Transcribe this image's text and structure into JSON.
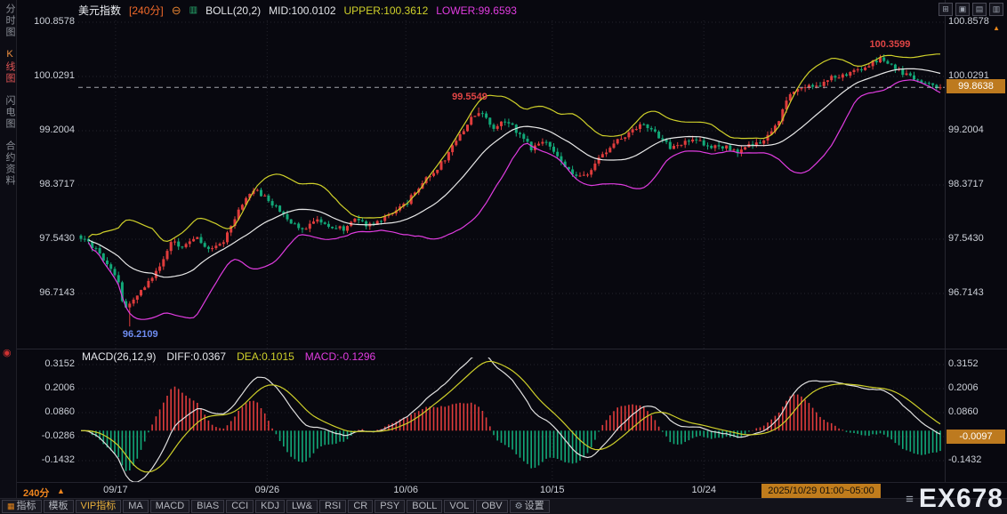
{
  "header": {
    "symbol": "美元指数",
    "period_tag": "[240分]",
    "boll_label": "BOLL(20,2)",
    "mid": "MID:100.0102",
    "upper": "UPPER:100.3612",
    "lower": "LOWER:99.6593"
  },
  "sidebar": {
    "tabs": [
      {
        "label": "分时图",
        "active": false
      },
      {
        "label": "K线图",
        "active": true
      },
      {
        "label": "闪电图",
        "active": false
      },
      {
        "label": "合约资料",
        "active": false
      }
    ]
  },
  "axis": {
    "price_labels": [
      "100.8578",
      "100.0291",
      "99.2004",
      "98.3717",
      "97.5430",
      "96.7143"
    ],
    "price_values": [
      100.8578,
      100.0291,
      99.2004,
      98.3717,
      97.543,
      96.7143
    ],
    "current_price": "99.8638",
    "macd_labels": [
      "0.3152",
      "0.2006",
      "0.0860",
      "-0.0286",
      "-0.1432"
    ],
    "macd_values": [
      0.3152,
      0.2006,
      0.086,
      -0.0286,
      -0.1432
    ],
    "macd_current": "-0.0097"
  },
  "annotations": {
    "low": "96.2109",
    "mid_peak": "99.5549",
    "high": "100.3599"
  },
  "macd_header": {
    "title": "MACD(26,12,9)",
    "diff": "DIFF:0.0367",
    "dea": "DEA:0.1015",
    "macd": "MACD:-0.1296"
  },
  "xaxis": {
    "period": "240分",
    "dates": [
      "09/17",
      "09/26",
      "10/06",
      "10/15",
      "10/24"
    ],
    "date_fracs": [
      0.043,
      0.218,
      0.378,
      0.547,
      0.722
    ],
    "current_range": "2025/10/29 01:00~05:00"
  },
  "toolbar": {
    "items": [
      "指标",
      "模板",
      "VIP指标",
      "MA",
      "MACD",
      "BIAS",
      "CCI",
      "KDJ",
      "LW&",
      "RSI",
      "CR",
      "PSY",
      "BOLL",
      "VOL",
      "OBV",
      "设置"
    ],
    "keys": [
      "indicators",
      "templates",
      "vip-indicators",
      "ma",
      "macd",
      "bias",
      "cci",
      "kdj",
      "lwr",
      "rsi",
      "cr",
      "psy",
      "boll",
      "vol",
      "obv",
      "settings"
    ],
    "vip_label": "VIP指标"
  },
  "watermark": {
    "text": "EX678"
  },
  "icons": {
    "zoom_out": "⊖",
    "boll_chart": "▥",
    "layout_grid": [
      "⊞",
      "▣",
      "▤",
      "▥"
    ],
    "gear": "⚙",
    "up_triangle": "▲",
    "red_dot": "◉",
    "menu": "≡",
    "indicator_grid": "▦"
  },
  "colors": {
    "up": "#e03c3c",
    "down": "#12a878",
    "boll_upper": "#cfd02a",
    "boll_mid": "#e8e8e8",
    "boll_lower": "#e03ce0",
    "diff_line": "#e0e0e0",
    "dea_line": "#cfd02a",
    "accent_orange": "#f0861e",
    "badge_bg": "#bd7a1f",
    "annotation_red": "#e04545",
    "annotation_blue": "#6e8cf0"
  },
  "chart_data": {
    "type": "candlestick",
    "title": "美元指数 240分 K线 + BOLL(20,2) + MACD(26,12,9)",
    "x_dates": [
      "09/17",
      "09/26",
      "10/06",
      "10/15",
      "10/24",
      "2025/10/29"
    ],
    "ylim": [
      95.9,
      100.95
    ],
    "price_gridlines": [
      100.8578,
      100.0291,
      99.2004,
      98.3717,
      97.543,
      96.7143
    ],
    "macd_gridlines": [
      0.3152,
      0.2006,
      0.086,
      -0.0286,
      -0.1432
    ],
    "key_points": {
      "low": 96.2109,
      "interim_high": 99.5549,
      "high": 100.3599,
      "last": 99.8638
    },
    "indicators": {
      "boll": {
        "period": 20,
        "mult": 2,
        "mid": 100.0102,
        "upper": 100.3612,
        "lower": 99.6593
      },
      "macd": {
        "fast": 12,
        "slow": 26,
        "signal": 9,
        "diff": 0.0367,
        "dea": 0.1015,
        "hist": -0.1296,
        "hist_at_axis": -0.0097
      }
    },
    "price_path": [
      [
        0,
        97.58
      ],
      [
        0.02,
        97.35
      ],
      [
        0.043,
        96.9
      ],
      [
        0.05,
        96.5
      ],
      [
        0.058,
        96.55
      ],
      [
        0.07,
        96.75
      ],
      [
        0.09,
        97.1
      ],
      [
        0.105,
        97.5
      ],
      [
        0.12,
        97.42
      ],
      [
        0.135,
        97.58
      ],
      [
        0.15,
        97.35
      ],
      [
        0.165,
        97.5
      ],
      [
        0.18,
        97.9
      ],
      [
        0.2,
        98.32
      ],
      [
        0.215,
        98.18
      ],
      [
        0.23,
        98.0
      ],
      [
        0.245,
        97.78
      ],
      [
        0.26,
        97.68
      ],
      [
        0.275,
        97.85
      ],
      [
        0.29,
        97.75
      ],
      [
        0.305,
        97.7
      ],
      [
        0.32,
        97.85
      ],
      [
        0.335,
        97.75
      ],
      [
        0.35,
        97.85
      ],
      [
        0.365,
        97.95
      ],
      [
        0.378,
        98.08
      ],
      [
        0.395,
        98.38
      ],
      [
        0.41,
        98.55
      ],
      [
        0.425,
        98.8
      ],
      [
        0.44,
        99.1
      ],
      [
        0.455,
        99.42
      ],
      [
        0.465,
        99.5
      ],
      [
        0.48,
        99.25
      ],
      [
        0.495,
        99.38
      ],
      [
        0.51,
        99.15
      ],
      [
        0.525,
        98.92
      ],
      [
        0.54,
        99.05
      ],
      [
        0.555,
        98.8
      ],
      [
        0.575,
        98.5
      ],
      [
        0.59,
        98.55
      ],
      [
        0.605,
        98.8
      ],
      [
        0.62,
        99.0
      ],
      [
        0.64,
        99.2
      ],
      [
        0.655,
        99.32
      ],
      [
        0.67,
        99.15
      ],
      [
        0.685,
        98.95
      ],
      [
        0.7,
        99.0
      ],
      [
        0.715,
        99.1
      ],
      [
        0.73,
        98.95
      ],
      [
        0.75,
        98.95
      ],
      [
        0.765,
        98.85
      ],
      [
        0.78,
        99.0
      ],
      [
        0.795,
        99.05
      ],
      [
        0.81,
        99.3
      ],
      [
        0.825,
        99.75
      ],
      [
        0.84,
        99.9
      ],
      [
        0.855,
        99.85
      ],
      [
        0.87,
        100.0
      ],
      [
        0.885,
        100.05
      ],
      [
        0.9,
        100.1
      ],
      [
        0.915,
        100.2
      ],
      [
        0.93,
        100.3
      ],
      [
        0.945,
        100.18
      ],
      [
        0.96,
        100.05
      ],
      [
        0.975,
        99.95
      ],
      [
        0.99,
        99.9
      ],
      [
        1,
        99.8638
      ]
    ]
  }
}
